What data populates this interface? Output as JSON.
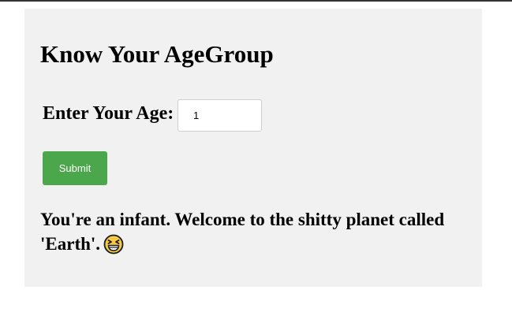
{
  "form": {
    "title": "Know Your AgeGroup",
    "age_label": "Enter Your Age:",
    "age_value": "1",
    "submit_label": "Submit"
  },
  "result": {
    "message": "You're an infant. Welcome to the shitty planet called 'Earth'.",
    "emoji_icon": "laughing-squinting-face-icon"
  },
  "colors": {
    "submit_bg": "#4ca64c",
    "card_bg": "#f1f1f1",
    "emoji_fill": "#f7c948"
  }
}
